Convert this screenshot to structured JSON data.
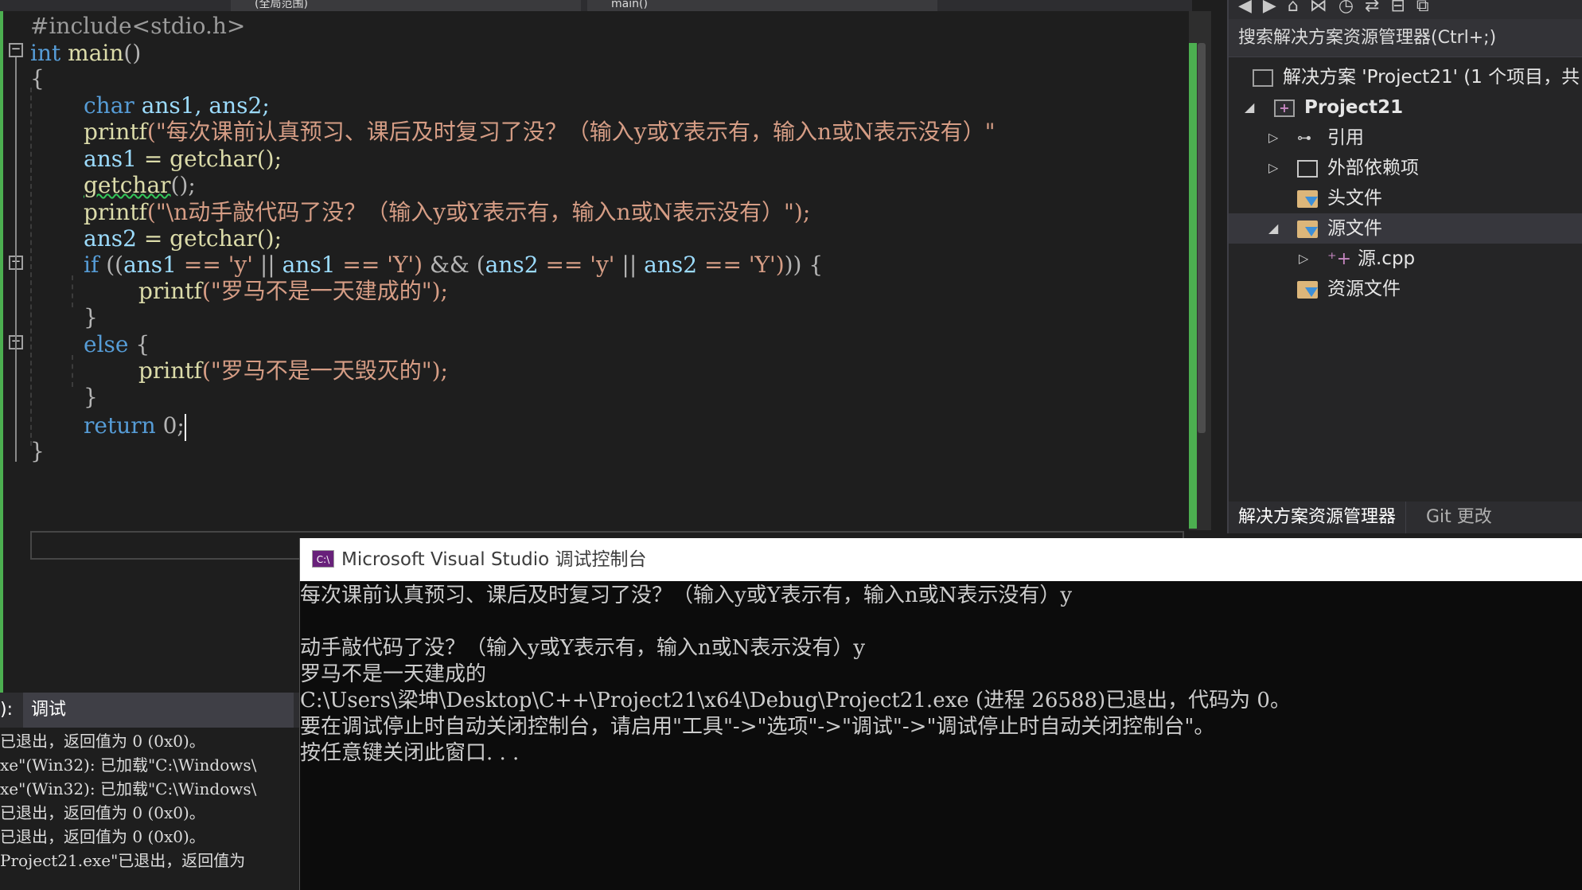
{
  "top_tabs": {
    "scope": "(全局范围)",
    "member": "main()"
  },
  "code": {
    "line1": "#include<stdio.h>",
    "kw_int": "int",
    "fn_main": "main",
    "parens": "()",
    "open_brace": "{",
    "close_brace": "}",
    "kw_char": "char",
    "vars_decl": "ans1, ans2;",
    "printf": "printf",
    "str1": "(\"每次课前认真预习、课后及时复习了没？（输入y或Y表示有，输入n或N表示没有）\"",
    "ans1": "ans1",
    "ans2": "ans2",
    "assign_getchar": " = getchar();",
    "getchar_call": "getchar",
    "getchar_tail": "();",
    "str2": "(\"\\n动手敲代码了没？（输入y或Y表示有，输入n或N表示没有）\");",
    "kw_if": "if",
    "if_cond_a": " ((",
    "if_eq_y": " == 'y'",
    "if_or": " || ",
    "if_eq_Y": " == 'Y')",
    "if_and": " && (",
    "if_end": ")) {",
    "str3": "(\"罗马不是一天建成的\");",
    "kw_else": "else",
    "else_brace": " {",
    "str4": "(\"罗马不是一天毁灭的\");",
    "kw_return": "return",
    "return_val": " 0;"
  },
  "solution_explorer": {
    "search_placeholder": "搜索解决方案资源管理器(Ctrl+;)",
    "solution": "解决方案 'Project21' (1 个项目，共",
    "project": "Project21",
    "items": [
      "引用",
      "外部依赖项",
      "头文件",
      "源文件",
      "源.cpp",
      "资源文件"
    ],
    "tabs": [
      "解决方案资源管理器",
      "Git 更改"
    ]
  },
  "output": {
    "header_prefix": "):",
    "header_value": "调试",
    "lines": [
      "已退出，返回值为 0 (0x0)。",
      "xe\"(Win32): 已加载\"C:\\Windows\\",
      "xe\"(Win32): 已加载\"C:\\Windows\\",
      "已退出，返回值为 0 (0x0)。",
      "已退出，返回值为 0 (0x0)。",
      "Project21.exe\"已退出，返回值为"
    ]
  },
  "console": {
    "title": "Microsoft Visual Studio 调试控制台",
    "icon_text": "C:\\",
    "lines": [
      "每次课前认真预习、课后及时复习了没？（输入y或Y表示有，输入n或N表示没有）y",
      "",
      "动手敲代码了没？（输入y或Y表示有，输入n或N表示没有）y",
      "罗马不是一天建成的",
      "C:\\Users\\梁坤\\Desktop\\C++\\Project21\\x64\\Debug\\Project21.exe (进程 26588)已退出，代码为 0。",
      "要在调试停止时自动关闭控制台，请启用\"工具\"->\"选项\"->\"调试\"->\"调试停止时自动关闭控制台\"。",
      "按任意键关闭此窗口. . ."
    ]
  },
  "colors": {
    "keyword": "#569cd6",
    "function": "#dcdcaa",
    "variable": "#9cdcfe",
    "string": "#d69d85",
    "accent_green": "#4caf50"
  }
}
